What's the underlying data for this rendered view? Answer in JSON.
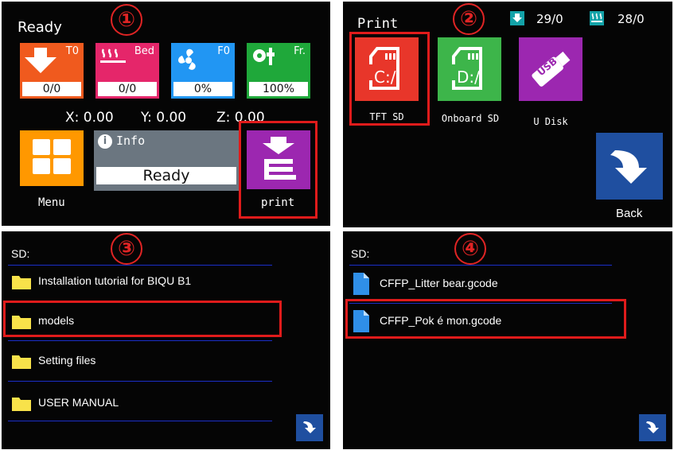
{
  "colors": {
    "badge": "#e02424",
    "highlight": "#e01b1b",
    "divider": "#1a2ec8"
  },
  "panel1": {
    "badge": "①",
    "status": "Ready",
    "tiles": [
      {
        "name": "nozzle",
        "label": "T0",
        "value": "0/0",
        "color": "#f05a1e",
        "icon": "nozzle-icon"
      },
      {
        "name": "bed",
        "label": "Bed",
        "value": "0/0",
        "color": "#e5266a",
        "icon": "bed-heat-icon"
      },
      {
        "name": "fan",
        "label": "F0",
        "value": "0%",
        "color": "#2196f3",
        "icon": "fan-icon"
      },
      {
        "name": "speed",
        "label": "Fr.",
        "value": "100%",
        "color": "#1fa83a",
        "icon": "speed-gear-icon"
      }
    ],
    "coords": {
      "x": "X: 0.00",
      "y": "Y: 0.00",
      "z": "Z: 0.00"
    },
    "menu_label": "Menu",
    "info_title": "Info",
    "info_status": "Ready",
    "print_label": "print"
  },
  "panel2": {
    "badge": "②",
    "title": "Print",
    "nozzle_temp": "29/0",
    "bed_temp": "28/0",
    "sources": [
      {
        "label": "TFT  SD",
        "card_text": "C:/",
        "color": "#e8362a"
      },
      {
        "label": "Onboard SD",
        "card_text": "D:/",
        "color": "#3db54a"
      },
      {
        "label": "U Disk",
        "card_text": "USB",
        "color": "#9c27b0"
      }
    ],
    "back_label": "Back"
  },
  "panel3": {
    "badge": "③",
    "title": "SD:",
    "items": [
      "Installation tutorial for BIQU B1",
      "models",
      "Setting files",
      "USER MANUAL"
    ]
  },
  "panel4": {
    "badge": "④",
    "title": "SD:",
    "items": [
      "CFFP_Litter bear.gcode",
      "CFFP_Pok é mon.gcode"
    ]
  }
}
